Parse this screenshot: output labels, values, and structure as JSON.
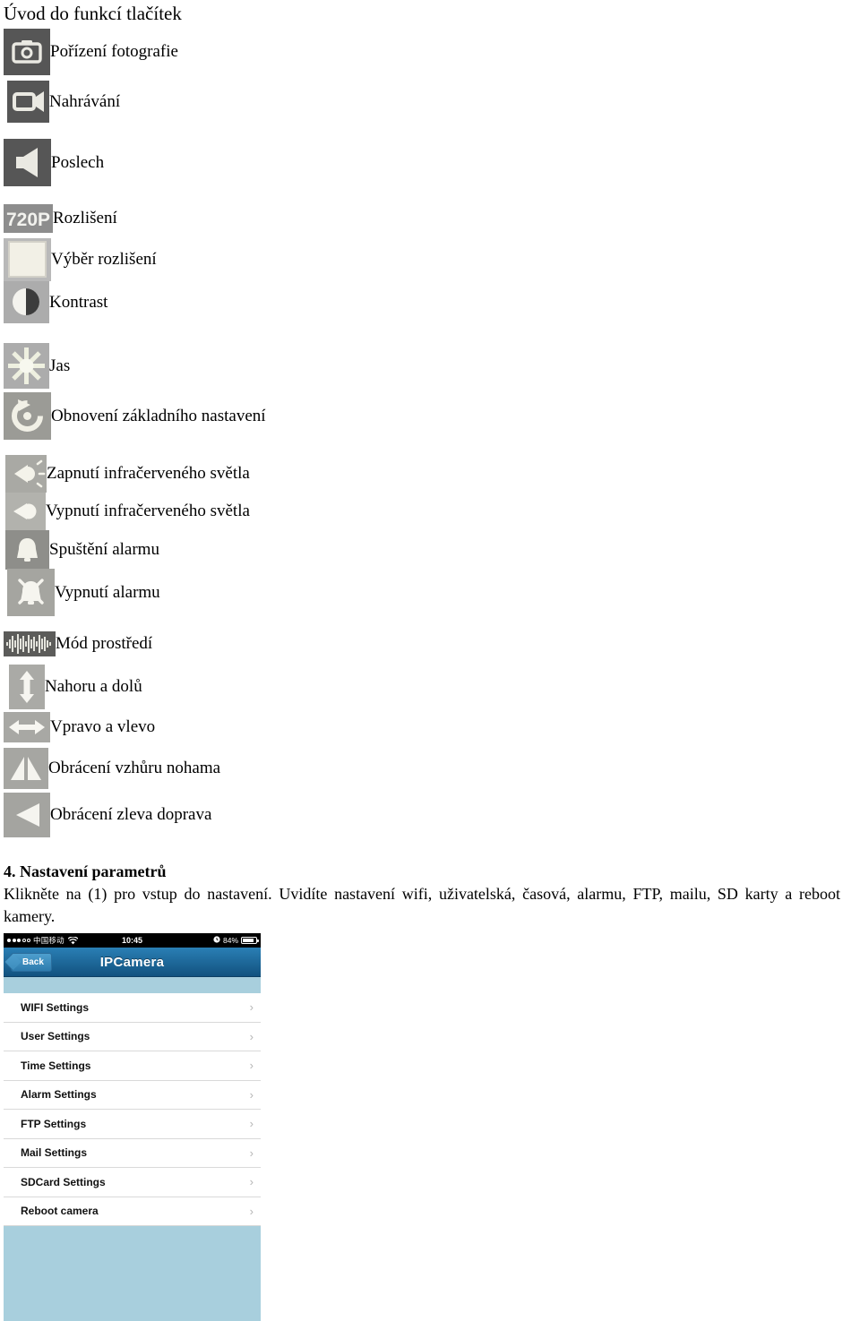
{
  "document": {
    "title": "Úvod do funkcí tlačítek"
  },
  "legend": {
    "items": [
      {
        "icon": "camera-icon",
        "label": "Pořízení fotografie"
      },
      {
        "icon": "video-camera-icon",
        "label": "Nahrávání"
      },
      {
        "icon": "speaker-icon",
        "label": "Poslech"
      },
      {
        "icon": "720p-icon",
        "label": "Rozlišení"
      },
      {
        "icon": "resolution-square-icon",
        "label": "Výběr rozlišení"
      },
      {
        "icon": "contrast-icon",
        "label": "Kontrast"
      },
      {
        "icon": "brightness-icon",
        "label": "Jas"
      },
      {
        "icon": "reset-icon",
        "label": "Obnovení základního nastavení"
      },
      {
        "icon": "ir-light-on-icon",
        "label": "Zapnutí infračerveného světla"
      },
      {
        "icon": "ir-light-off-icon",
        "label": "Vypnutí infračerveného světla"
      },
      {
        "icon": "bell-on-icon",
        "label": "Spuštění alarmu"
      },
      {
        "icon": "bell-off-icon",
        "label": "Vypnutí alarmu"
      },
      {
        "icon": "waveform-icon",
        "label": "Mód prostředí"
      },
      {
        "icon": "arrow-updown-icon",
        "label": "Nahoru a dolů"
      },
      {
        "icon": "arrow-leftright-icon",
        "label": "Vpravo a vlevo"
      },
      {
        "icon": "flip-vertical-icon",
        "label": "Obrácení vzhůru nohama"
      },
      {
        "icon": "flip-horizontal-icon",
        "label": "Obrácení zleva doprava"
      }
    ]
  },
  "section4": {
    "heading": "4. Nastavení parametrů",
    "body": "Klikněte na (1) pro vstup do nastavení. Uvidíte nastavení wifi, uživatelská, časová, alarmu, FTP, mailu, SD karty a reboot kamery."
  },
  "phone": {
    "status_bar": {
      "carrier": "中国移动",
      "time": "10:45",
      "battery_percent": "84%"
    },
    "nav": {
      "back_label": "Back",
      "title": "IPCamera"
    },
    "settings": [
      {
        "label": "WIFI Settings",
        "chevron": "›"
      },
      {
        "label": "User Settings",
        "chevron": "›"
      },
      {
        "label": "Time Settings",
        "chevron": "›"
      },
      {
        "label": "Alarm Settings",
        "chevron": "›"
      },
      {
        "label": "FTP Settings",
        "chevron": "›"
      },
      {
        "label": "Mail Settings",
        "chevron": "›"
      },
      {
        "label": "SDCard Settings",
        "chevron": "›"
      },
      {
        "label": "Reboot camera",
        "chevron": "›"
      }
    ]
  },
  "colors": {
    "icon_dark": "#565656",
    "icon_light": "#acacac",
    "nav_blue": "#1a5f90",
    "panel_blue": "#a8cfdd"
  }
}
